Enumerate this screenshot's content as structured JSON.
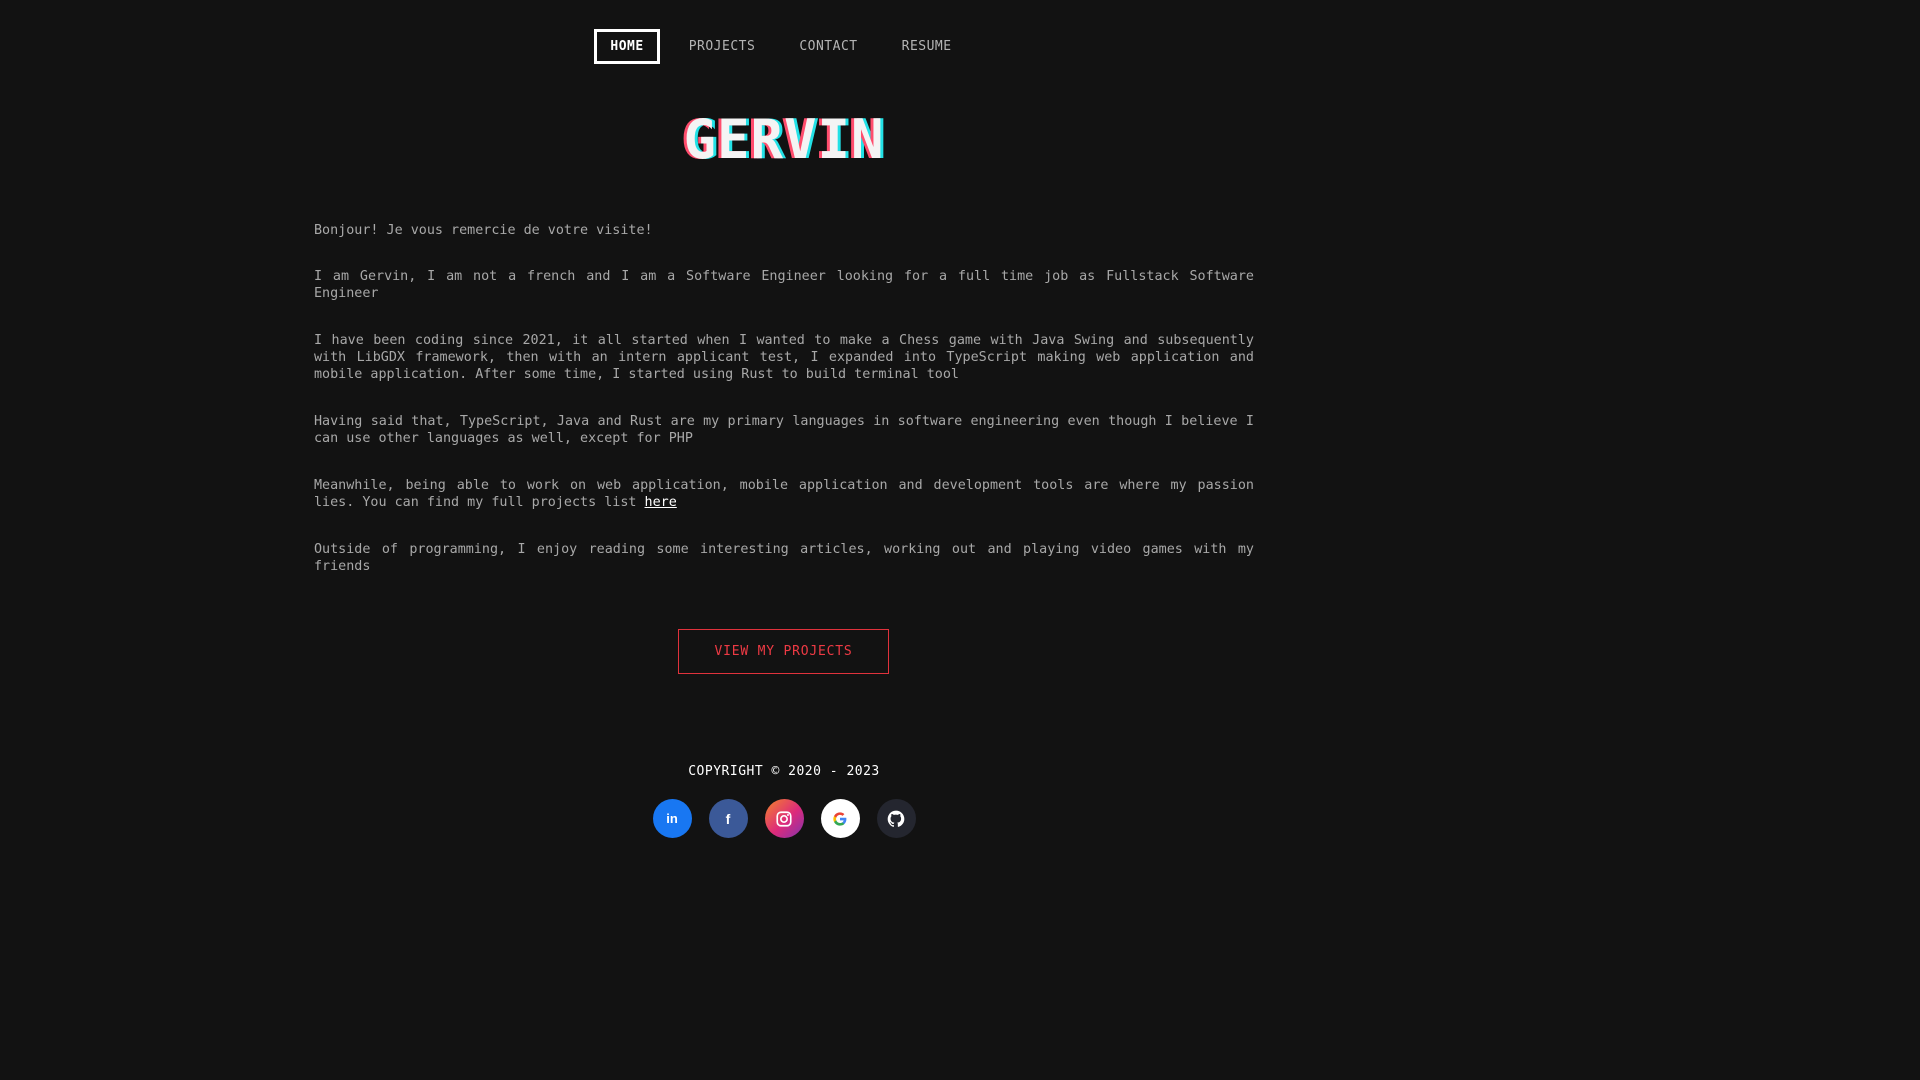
{
  "nav": {
    "items": [
      {
        "label": "HOME",
        "active": true
      },
      {
        "label": "PROJECTS",
        "active": false
      },
      {
        "label": "CONTACT",
        "active": false
      },
      {
        "label": "RESUME",
        "active": false
      }
    ]
  },
  "hero": {
    "title": "GERVIN"
  },
  "about": {
    "p1": "Bonjour! Je vous remercie de votre visite!",
    "p2": "I am Gervin, I am not a french and I am a Software Engineer looking for a full time job as Fullstack Software Engineer",
    "p3": "I have been coding since 2021, it all started when I wanted to make a Chess game with Java Swing and subsequently with LibGDX framework, then with an intern applicant test, I expanded into TypeScript making web application and mobile application. After some time, I started using Rust to build terminal tool",
    "p4": "Having said that, TypeScript, Java and Rust are my primary languages in software engineering even though I believe I can use other languages as well, except for PHP",
    "p5_before_link": "Meanwhile, being able to work on web application, mobile application and development tools are where my passion lies. You can find my full projects list ",
    "p5_link": "here",
    "p6": "Outside of programming, I enjoy reading some interesting articles, working out and playing video games with my friends"
  },
  "cta": {
    "label": "VIEW MY PROJECTS",
    "color": "#ee3a44"
  },
  "footer": {
    "copyright": "COPYRIGHT © 2020 - 2023",
    "socials": [
      {
        "name": "linkedin-icon",
        "text": "in",
        "bg": "#1877f2"
      },
      {
        "name": "facebook-icon",
        "text": "f",
        "bg": "#3b5998"
      },
      {
        "name": "instagram-icon",
        "text": "",
        "bg": "#e1306c"
      },
      {
        "name": "google-icon",
        "text": "G",
        "bg": "#ffffff"
      },
      {
        "name": "github-icon",
        "text": "",
        "bg": "#24292e"
      }
    ]
  },
  "colors": {
    "background": "#121212",
    "title_shadow_left": "#ff4d6d",
    "title_shadow_right": "#22e1e6",
    "cta_accent": "#e0323c"
  }
}
